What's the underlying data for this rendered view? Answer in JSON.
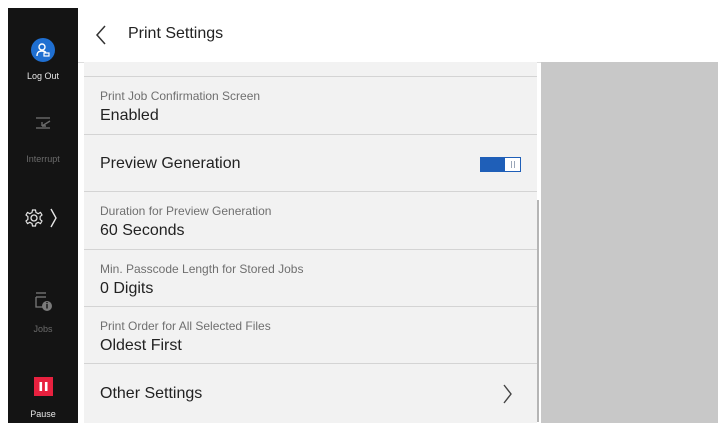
{
  "sidebar": {
    "logout_label": "Log Out",
    "interrupt_label": "Interrupt",
    "jobs_label": "Jobs",
    "pause_label": "Pause"
  },
  "header": {
    "title": "Print Settings"
  },
  "settings": [
    {
      "label": "Print Job Confirmation Screen",
      "value": "Enabled"
    },
    {
      "label": "Preview Generation",
      "toggle": true
    },
    {
      "label": "Duration for Preview Generation",
      "value": "60 Seconds"
    },
    {
      "label": "Min. Passcode Length for Stored Jobs",
      "value": "0 Digits"
    },
    {
      "label": "Print Order for All Selected Files",
      "value": "Oldest First"
    },
    {
      "label": "Other Settings"
    }
  ],
  "colors": {
    "sidebar_bg": "#141414",
    "logout_blue": "#1f6fd1",
    "pause_red": "#e8213f",
    "toggle_blue": "#1f5fb8",
    "right_pane": "#c8c8c8"
  }
}
